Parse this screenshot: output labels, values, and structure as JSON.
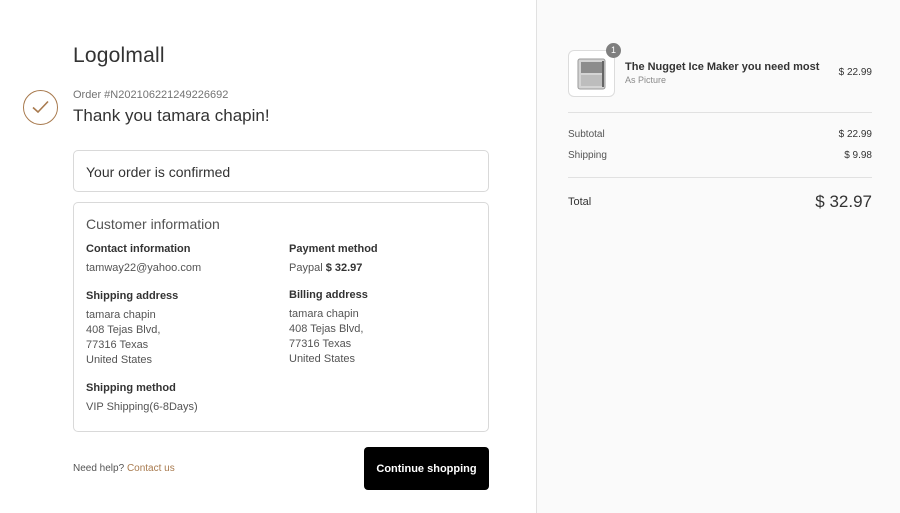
{
  "store": {
    "name": "Logolmall"
  },
  "order": {
    "number": "Order #N202106221249226692",
    "thanks": "Thank you tamara chapin!",
    "confirmed": "Your order is confirmed"
  },
  "customer": {
    "title": "Customer information",
    "contact": {
      "label": "Contact information",
      "email": "tamway22@yahoo.com"
    },
    "payment": {
      "label": "Payment method",
      "method": "Paypal",
      "amount": "$ 32.97"
    },
    "shipping_address": {
      "label": "Shipping address",
      "lines": [
        "tamara chapin",
        "408 Tejas Blvd,",
        "77316 Texas",
        "United States"
      ]
    },
    "billing_address": {
      "label": "Billing address",
      "lines": [
        "tamara chapin",
        "408 Tejas Blvd,",
        "77316 Texas",
        "United States"
      ]
    },
    "shipping_method": {
      "label": "Shipping method",
      "value": "VIP Shipping(6-8Days)"
    }
  },
  "footer": {
    "help_text": "Need help?",
    "contact_link": "Contact us",
    "continue_button": "Continue shopping"
  },
  "summary": {
    "item": {
      "quantity": "1",
      "name": "The Nugget Ice Maker you need most",
      "variant": "As Picture",
      "price": "$ 22.99"
    },
    "subtotal_label": "Subtotal",
    "subtotal": "$ 22.99",
    "shipping_label": "Shipping",
    "shipping": "$ 9.98",
    "total_label": "Total",
    "total": "$ 32.97"
  },
  "colors": {
    "accent": "#a87a4e",
    "button": "#000000",
    "sidebar_bg": "#fafafa"
  },
  "icons": {
    "confirmation": "checkmark-icon",
    "product": "ice-maker-product-image"
  }
}
